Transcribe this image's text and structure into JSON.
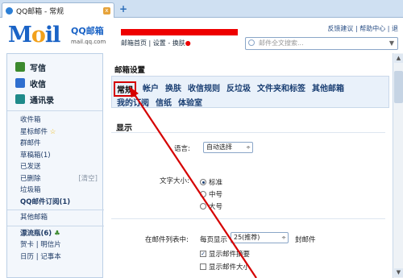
{
  "browser": {
    "tab_title": "QQ邮箱 - 常规",
    "close_label": "x",
    "new_tab_label": "+"
  },
  "header": {
    "logo_text_1": "M",
    "logo_text_2": "o",
    "logo_text_3": "il",
    "logo_cn": "QQ邮箱",
    "logo_url": "mail.qq.com",
    "nav": [
      "邮箱首页",
      "设置",
      "换肤"
    ],
    "links": [
      "反馈建议",
      "帮助中心",
      "退"
    ],
    "search_placeholder": "邮件全文搜索..."
  },
  "sidebar": {
    "actions": [
      {
        "label": "写信",
        "icon": "write-icon"
      },
      {
        "label": "收信",
        "icon": "inbox-icon"
      },
      {
        "label": "通讯录",
        "icon": "contacts-icon"
      }
    ],
    "folders": [
      {
        "label": "收件箱"
      },
      {
        "label": "星标邮件",
        "suffix": "☆"
      },
      {
        "label": "群邮件"
      },
      {
        "label": "草稿箱(1)"
      },
      {
        "label": "已发送"
      },
      {
        "label": "已删除",
        "extra": "[清空]"
      },
      {
        "label": "垃圾箱"
      },
      {
        "label": "QQ邮件订阅(1)",
        "bold": true
      }
    ],
    "other": "其他邮箱",
    "drift": "漂流瓶(6)",
    "bottom1_a": "贺卡",
    "bottom1_b": "明信片",
    "bottom2_a": "日历",
    "bottom2_b": "记事本"
  },
  "main": {
    "title": "邮箱设置",
    "tabs_row1": [
      "常规",
      "帐户",
      "换肤",
      "收信规则",
      "反垃圾",
      "文件夹和标签",
      "其他邮箱"
    ],
    "tabs_row2": [
      "我的订阅",
      "信纸",
      "体验室"
    ],
    "active_tab": "常规",
    "section": "显示",
    "language_label": "语言:",
    "language_value": "自动选择",
    "font_size_label": "文字大小:",
    "font_sizes": [
      "标准",
      "中号",
      "大号"
    ],
    "list_label": "在邮件列表中:",
    "per_page_prefix": "每页显示",
    "per_page_value": "25(推荐)",
    "per_page_suffix": "封邮件",
    "show_summary": "显示邮件摘要",
    "show_size": "显示邮件大小"
  },
  "colors": {
    "accent": "#1a63c6",
    "annotation": "#d50000"
  }
}
